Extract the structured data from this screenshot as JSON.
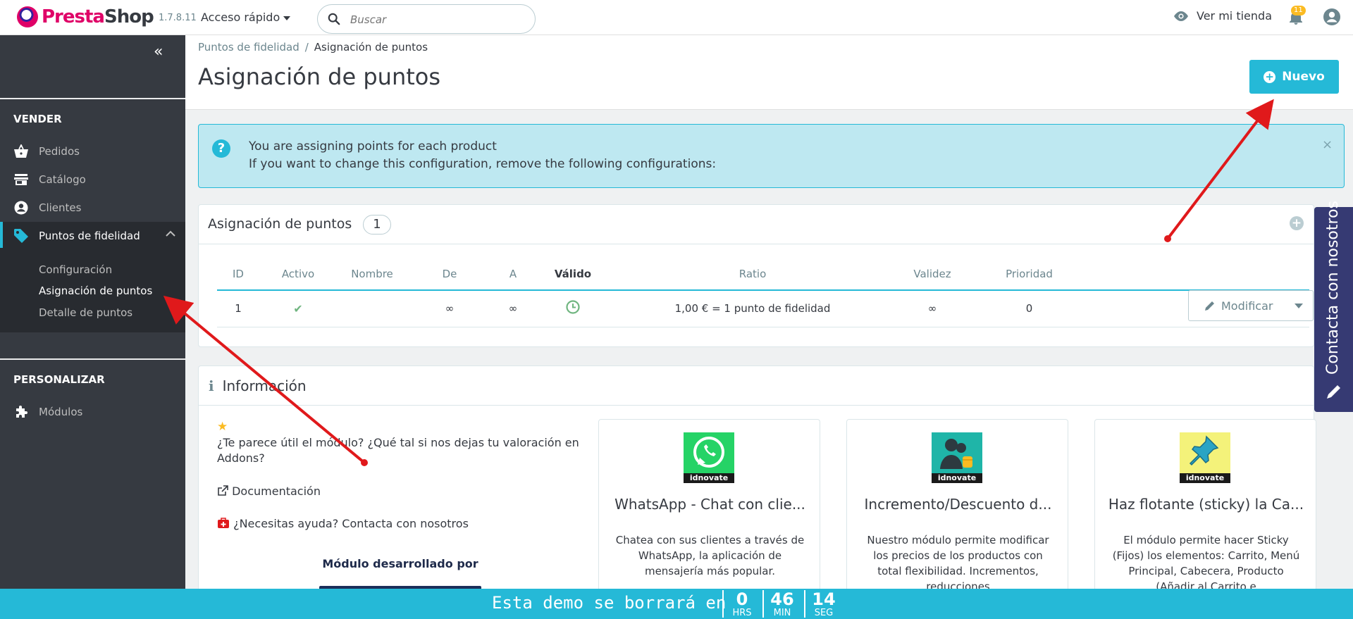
{
  "header": {
    "logo_text_a": "Presta",
    "logo_text_b": "Shop",
    "version": "1.7.8.11",
    "quick_access": "Acceso rápido",
    "search_placeholder": "Buscar",
    "view_store": "Ver mi tienda",
    "notifications_count": "11"
  },
  "sidebar": {
    "section_sell": "VENDER",
    "items": [
      {
        "label": "Pedidos",
        "icon": "basket-icon"
      },
      {
        "label": "Catálogo",
        "icon": "store-icon"
      },
      {
        "label": "Clientes",
        "icon": "account-icon"
      },
      {
        "label": "Puntos de fidelidad",
        "icon": "tag-icon"
      }
    ],
    "submenu": [
      {
        "label": "Configuración"
      },
      {
        "label": "Asignación de puntos"
      },
      {
        "label": "Detalle de puntos"
      }
    ],
    "section_customize": "PERSONALIZAR",
    "modules_label": "Módulos"
  },
  "breadcrumb": {
    "parent": "Puntos de fidelidad",
    "separator": "/",
    "current": "Asignación de puntos"
  },
  "page": {
    "title": "Asignación de puntos",
    "new_button": "Nuevo"
  },
  "alert": {
    "line1": "You are assigning points for each product",
    "line2": "If you want to change this configuration, remove the following configurations:",
    "close": "×"
  },
  "list_panel": {
    "title": "Asignación de puntos",
    "count": "1",
    "columns": [
      "ID",
      "Activo",
      "Nombre",
      "De",
      "A",
      "Válido",
      "Ratio",
      "Validez",
      "Prioridad"
    ],
    "rows": [
      {
        "id": "1",
        "active": "✔",
        "name": "",
        "from": "∞",
        "to": "∞",
        "valid": "clock",
        "ratio": "1,00 € = 1 punto de fidelidad",
        "validity": "∞",
        "priority": "0"
      }
    ],
    "modify_button": "Modificar"
  },
  "info_panel": {
    "title": "Información",
    "rate_text": "¿Te parece útil el módulo? ¿Qué tal si nos dejas tu valoración en Addons?",
    "documentation": "Documentación",
    "help": "¿Necesitas ayuda? Contacta con nosotros",
    "developed_by": "Módulo desarrollado por",
    "cards": [
      {
        "title": "WhatsApp - Chat con clie...",
        "desc": "Chatea con sus clientes a través de WhatsApp, la aplicación de mensajería más popular.",
        "brand": "idnovate",
        "color": "#25d366"
      },
      {
        "title": "Incremento/Descuento d...",
        "desc": "Nuestro módulo permite modificar los precios de los productos con total flexibilidad. Incrementos, reducciones",
        "brand": "idnovate",
        "color": "#1fb5a8"
      },
      {
        "title": "Haz flotante (sticky) la Ca...",
        "desc": "El módulo permite hacer Sticky (Fijos) los elementos: Carrito, Menú Principal, Cabecera, Producto (Añadir al Carrito e",
        "brand": "idnovate",
        "color": "#f4f27a"
      }
    ]
  },
  "contact_tab": {
    "label": "Contacta con nosotros"
  },
  "demo_bar": {
    "text": "Esta demo se borrará en",
    "hours": "0",
    "hours_unit": "HRS",
    "minutes": "46",
    "minutes_unit": "MIN",
    "seconds": "14",
    "seconds_unit": "SEG"
  },
  "colors": {
    "accent": "#25b9d7",
    "sidebar": "#363a41",
    "brand": "#df0067",
    "arrow": "#e0191b"
  }
}
